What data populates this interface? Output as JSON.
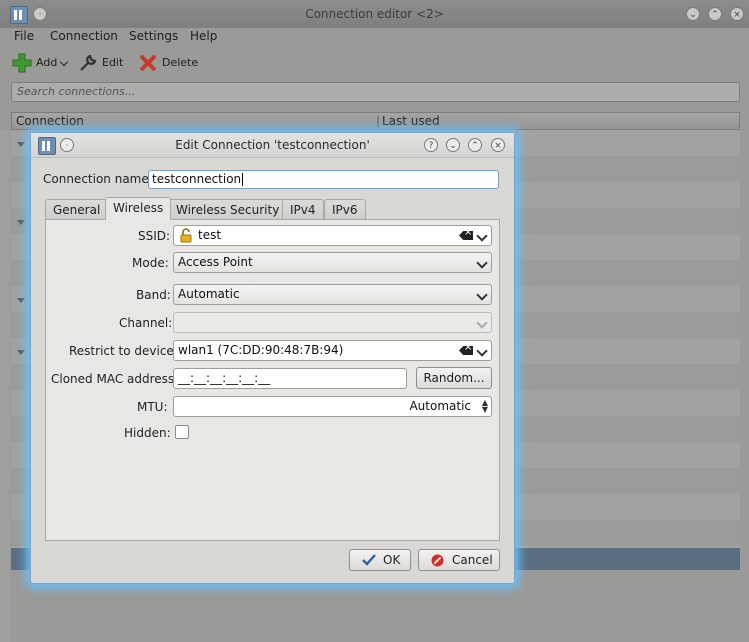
{
  "main_window": {
    "title": "Connection editor <2>",
    "menu": [
      "File",
      "Connection",
      "Settings",
      "Help"
    ],
    "toolbar": {
      "add": "Add",
      "edit": "Edit",
      "delete": "Delete"
    },
    "search_placeholder": "Search connections...",
    "columns": [
      "Connection",
      "Last used"
    ]
  },
  "dialog": {
    "title": "Edit Connection 'testconnection'",
    "connection_name_label": "Connection name:",
    "connection_name_value": "testconnection",
    "tabs": [
      "General",
      "Wireless",
      "Wireless Security",
      "IPv4",
      "IPv6"
    ],
    "active_tab": "Wireless",
    "fields": {
      "ssid_label": "SSID:",
      "ssid_value": "test",
      "mode_label": "Mode:",
      "mode_value": "Access Point",
      "band_label": "Band:",
      "band_value": "Automatic",
      "channel_label": "Channel:",
      "channel_value": "",
      "restrict_label": "Restrict to device:",
      "restrict_value": "wlan1 (7C:DD:90:48:7B:94)",
      "cloned_mac_label": "Cloned MAC address:",
      "cloned_mac_value": "__:__:__:__:__:__",
      "random_button": "Random...",
      "mtu_label": "MTU:",
      "mtu_value": "Automatic",
      "hidden_label": "Hidden:",
      "hidden_checked": false
    },
    "ok_button": "OK",
    "cancel_button": "Cancel"
  },
  "colors": {
    "accent_glow": "#67c3ff",
    "selection": "#5b6e82"
  }
}
